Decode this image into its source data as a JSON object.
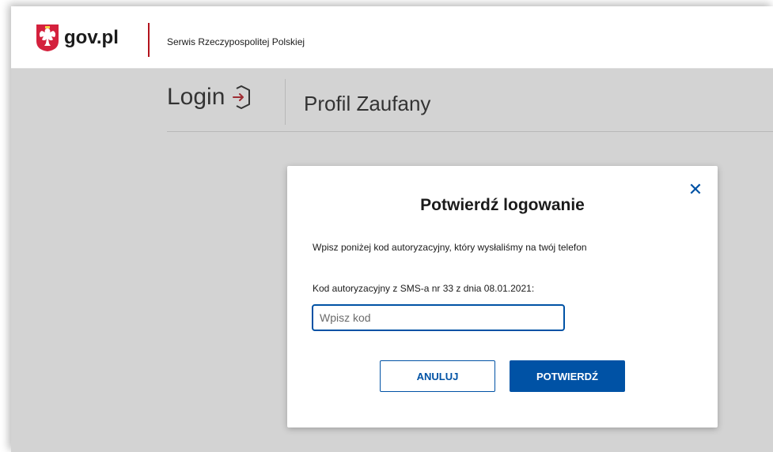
{
  "header": {
    "logo_text": "gov.pl",
    "service_name": "Serwis Rzeczypospolitej Polskiej"
  },
  "login": {
    "title": "Login",
    "profile_name": "Profil Zaufany"
  },
  "modal": {
    "title": "Potwierdź logowanie",
    "description": "Wpisz poniżej kod autoryzacyjny, który wysłaliśmy na twój telefon",
    "code_label": "Kod autoryzacyjny z SMS-a nr 33 z dnia 08.01.2021:",
    "code_placeholder": "Wpisz kod",
    "code_value": "",
    "cancel_label": "ANULUJ",
    "confirm_label": "POTWIERDŹ",
    "close_symbol": "✕"
  },
  "colors": {
    "brand_blue": "#0052a5",
    "accent_red": "#b3121c"
  },
  "icons": [
    "poland-emblem-icon",
    "login-arrow-icon",
    "close-icon"
  ]
}
